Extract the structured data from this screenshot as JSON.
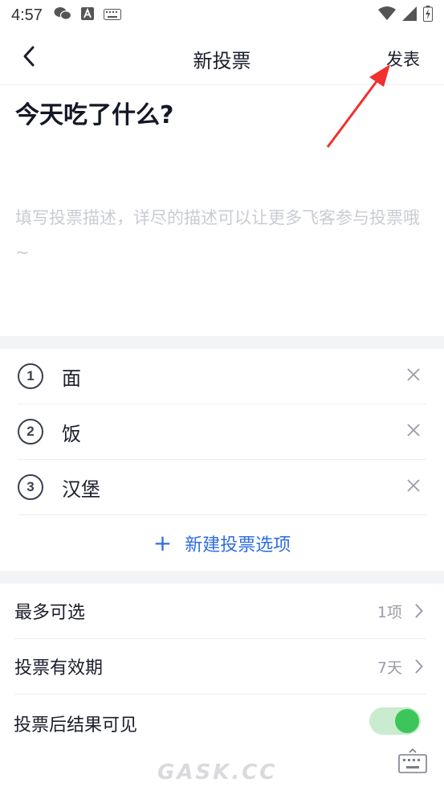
{
  "status_bar": {
    "time": "4:57",
    "left_icons": [
      "wechat-icon",
      "a-app-icon",
      "keyboard-indicator-icon"
    ],
    "right_icons": [
      "wifi-icon",
      "signal-icon",
      "battery-charging-icon"
    ]
  },
  "header": {
    "title": "新投票",
    "publish_label": "发表",
    "back_icon": "chevron-left-icon"
  },
  "annotation": {
    "arrow_color": "#f0312f"
  },
  "poll": {
    "title": "今天吃了什么?",
    "description_placeholder": "填写投票描述，详尽的描述可以让更多飞客参与投票哦~"
  },
  "options": [
    {
      "number": "1",
      "text": "面"
    },
    {
      "number": "2",
      "text": "饭"
    },
    {
      "number": "3",
      "text": "汉堡"
    }
  ],
  "add_option": {
    "plus": "+",
    "label": "新建投票选项"
  },
  "settings": [
    {
      "label": "最多可选",
      "value": "1项"
    },
    {
      "label": "投票有效期",
      "value": "7天"
    }
  ],
  "result_visible": {
    "label": "投票后结果可见",
    "enabled": true
  },
  "watermark": "GASK.CC",
  "colors": {
    "accent_blue": "#2e6de0",
    "toggle_on": "#3cc65a",
    "placeholder": "#c9ccd3",
    "section_gap": "#f3f4f6"
  }
}
